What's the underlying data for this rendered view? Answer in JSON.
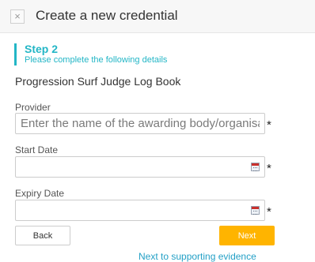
{
  "header": {
    "close_icon": "close-icon",
    "close_glyph": "×",
    "title": "Create a new credential"
  },
  "step": {
    "title": "Step 2",
    "subtitle": "Please complete the following details",
    "accent_color": "#23b6c6"
  },
  "credential_name": "Progression Surf Judge Log Book",
  "form": {
    "provider": {
      "label": "Provider",
      "value": "",
      "placeholder": "Enter the name of the awarding body/organisation",
      "required_mark": "*"
    },
    "start_date": {
      "label": "Start Date",
      "value": "",
      "icon": "calendar-icon",
      "required_mark": "*"
    },
    "expiry_date": {
      "label": "Expiry Date",
      "value": "",
      "icon": "calendar-icon",
      "required_mark": "*"
    }
  },
  "buttons": {
    "back_label": "Back",
    "next_label": "Next",
    "next_color": "#ffb400"
  },
  "next_link": "Next to supporting evidence"
}
